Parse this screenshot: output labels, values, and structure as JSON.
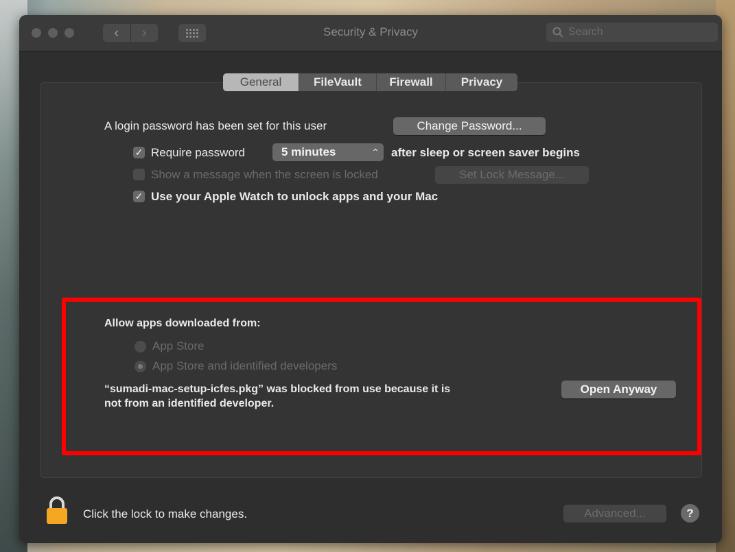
{
  "window": {
    "title": "Security & Privacy",
    "search_placeholder": "Search",
    "traffic_lights": [
      "close",
      "minimize",
      "zoom"
    ],
    "nav": {
      "back_icon": "chevron-left-icon",
      "forward_icon": "chevron-right-icon",
      "grid_icon": "grid-icon"
    }
  },
  "tabs": [
    {
      "label": "General",
      "selected": true
    },
    {
      "label": "FileVault",
      "selected": false
    },
    {
      "label": "Firewall",
      "selected": false
    },
    {
      "label": "Privacy",
      "selected": false
    }
  ],
  "general": {
    "login_password_text": "A login password has been set for this user",
    "change_password_label": "Change Password...",
    "require_password": {
      "checked": true,
      "label": "Require password",
      "delay_value": "5 minutes",
      "suffix": "after sleep or screen saver begins"
    },
    "show_message": {
      "checked": false,
      "enabled": false,
      "label": "Show a message when the screen is locked",
      "button_label": "Set Lock Message..."
    },
    "apple_watch": {
      "checked": true,
      "label": "Use your Apple Watch to unlock apps and your Mac"
    }
  },
  "allow_apps": {
    "heading": "Allow apps downloaded from:",
    "options": [
      {
        "label": "App Store",
        "selected": false,
        "enabled": false
      },
      {
        "label": "App Store and identified developers",
        "selected": true,
        "enabled": false
      }
    ],
    "blocked_line1": "“sumadi-mac-setup-icfes.pkg” was blocked from use because it is",
    "blocked_line2": "not from an identified developer.",
    "open_anyway_label": "Open Anyway"
  },
  "footer": {
    "lock_text": "Click the lock to make changes.",
    "advanced_label": "Advanced...",
    "help_label": "?"
  },
  "colors": {
    "highlight_box": "#ff0000",
    "lock": "#f5a623"
  }
}
